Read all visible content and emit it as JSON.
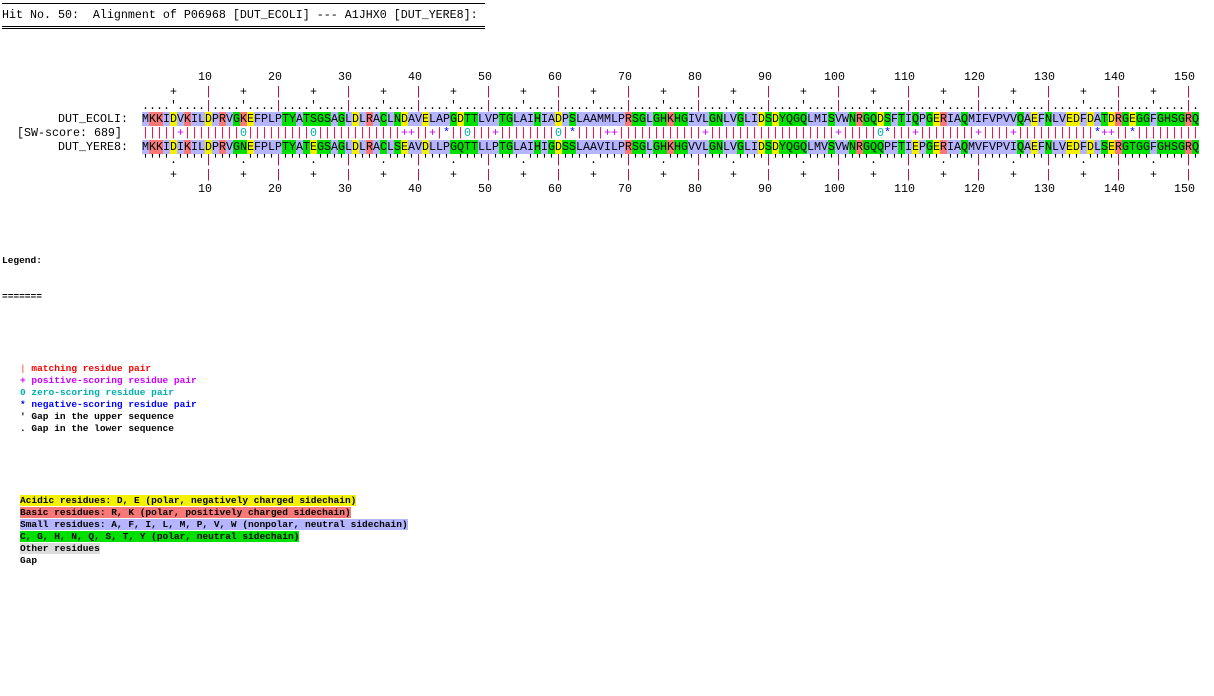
{
  "header": {
    "title": "Hit No. 50:  Alignment of P06968 [DUT_ECOLI] --- A1JHX0 [DUT_YERE8]:"
  },
  "alignment": {
    "upper_label": "DUT_ECOLI:",
    "score_label": "[SW-score: 689]",
    "lower_label": "DUT_YERE8:",
    "upper_sequence": "MKKIDVKILDPRVGKEFPLPTYATSGSAGLDLRACLNDAVELAPGDTTLVPTGLAIHIADPSLAAMMLPRSGLGHKHGIVLGNLVGLIDSDYQGQLMISVWNRGQDSFTIQPGERIAQMIFVPVVQAEFNLVEDFDATDRGEGGFGHSGRQ",
    "match_line": "|||||+||||||||0|||||||||0||||||||||||++||+|*||0|||+||||||||0|*||||++||||||||||||+||||||||||||||||||+|||||0*|||+||||||||+||||+|||||||||||*++||*|||||||||",
    "lower_sequence": "MKKIDIKILDPRVGNEFPLPTYATEGSAGLDLRACLSEAVDLLPGQTTLLPTGLAIHIGDSSLAAVILPRSGLGHKHGVVLGNLVGLIDSDYQGQLMVSVWNRGQQPFTIEPGERIAQMVFVPVIQAEFNLVEDFDLSERGTGGFGHSGRQ",
    "ruler_ticks": [
      "10",
      "20",
      "30",
      "40",
      "50",
      "60",
      "70",
      "80",
      "90",
      "100",
      "110",
      "120",
      "130",
      "140",
      "150"
    ]
  },
  "legend": {
    "title": "Legend:",
    "underline": "=======",
    "symbols": [
      {
        "symbol": "|",
        "text": "matching residue pair",
        "color": "#ff0000"
      },
      {
        "symbol": "+",
        "text": "positive-scoring residue pair",
        "color": "#cc00ff"
      },
      {
        "symbol": "0",
        "text": "zero-scoring residue pair",
        "color": "#00b0b0"
      },
      {
        "symbol": "*",
        "text": "negative-scoring residue pair",
        "color": "#0000ff"
      },
      {
        "symbol": "'",
        "text": "Gap in the upper sequence",
        "color": "#000000"
      },
      {
        "symbol": ".",
        "text": "Gap in the lower sequence",
        "color": "#000000"
      }
    ],
    "classes": [
      {
        "text": "Acidic residues: D, E (polar, negatively charged sidechain)",
        "color": "#f2f200"
      },
      {
        "text": "Basic residues: R, K (polar, positively charged sidechain)",
        "color": "#f87878"
      },
      {
        "text": "Small residues: A, F, I, L, M, P, V, W (nonpolar, neutral sidechain)",
        "color": "#b4b4ff"
      },
      {
        "text": "C, G, H, N, Q, S, T, Y (polar, neutral sidechain)",
        "color": "#00e000"
      },
      {
        "text": "Other residues",
        "color": "#dcdcdc"
      },
      {
        "text": "Gap",
        "color": "#ffffff"
      }
    ]
  }
}
